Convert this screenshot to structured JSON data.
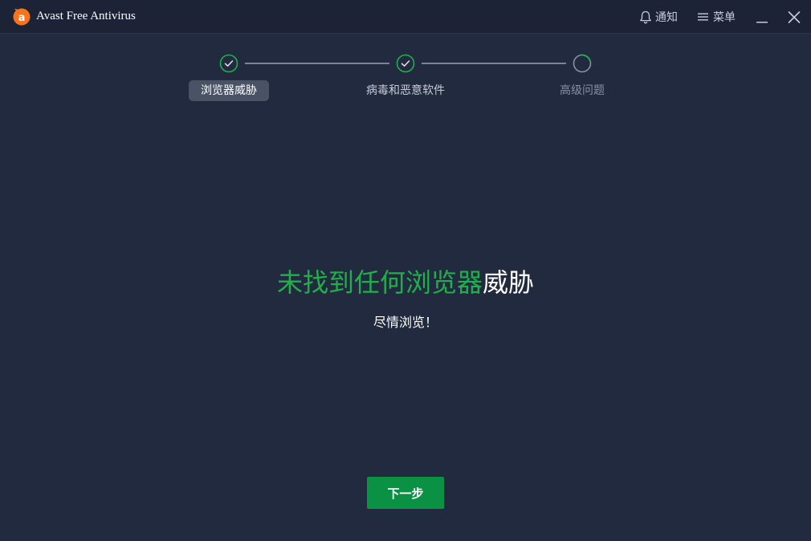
{
  "titlebar": {
    "app_title": "Avast Free Antivirus",
    "logo_icon": "avast-logo-icon",
    "notify_label": "通知",
    "menu_label": "菜单",
    "accent_color": "#f7731c"
  },
  "stepper": {
    "steps": [
      {
        "label": "浏览器威胁",
        "state": "completed-active"
      },
      {
        "label": "病毒和恶意软件",
        "state": "completed"
      },
      {
        "label": "高级问题",
        "state": "in-progress"
      }
    ],
    "check_color": "#20b04a"
  },
  "main": {
    "headline_green": "未找到任何浏览器",
    "headline_white": "威胁",
    "subline": "尽情浏览！",
    "next_button_label": "下一步",
    "button_color": "#0a9143"
  }
}
